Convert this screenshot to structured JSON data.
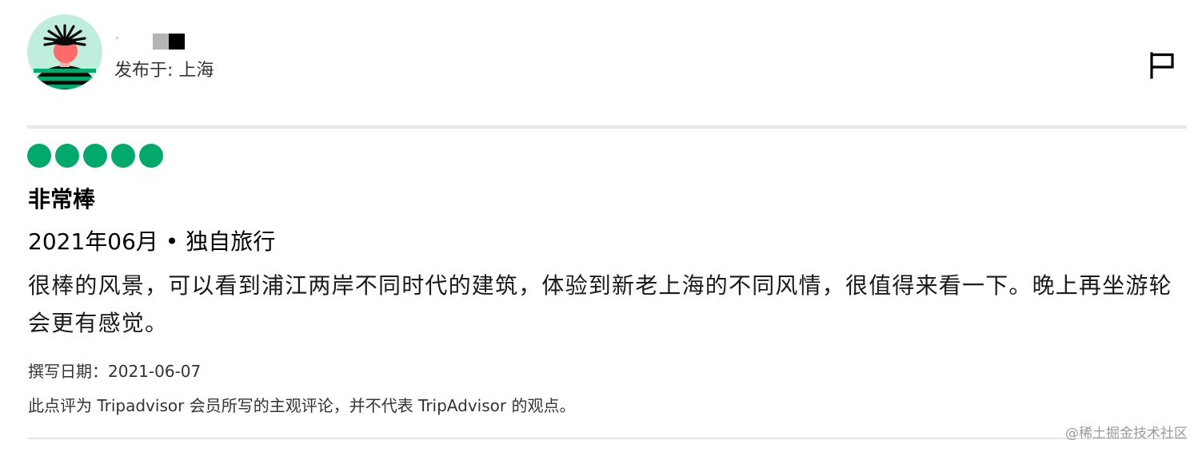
{
  "reviewer": {
    "avatar_icon": "illustrated-person-avatar-icon",
    "posted_from": "发布于: 上海"
  },
  "actions": {
    "flag_icon": "flag-icon"
  },
  "review": {
    "rating": 5,
    "rating_max": 5,
    "rating_color": "#00aa6c",
    "title": "非常棒",
    "trip_info": "2021年06月 • 独自旅行",
    "body": "很棒的风景，可以看到浦江两岸不同时代的建筑，体验到新老上海的不同风情，很值得来看一下。晚上再坐游轮会更有感觉。",
    "written_date": "撰写日期：2021-06-07",
    "disclaimer": "此点评为 Tripadvisor 会员所写的主观评论，并不代表 TripAdvisor 的观点。"
  },
  "watermark": "@稀土掘金技术社区"
}
